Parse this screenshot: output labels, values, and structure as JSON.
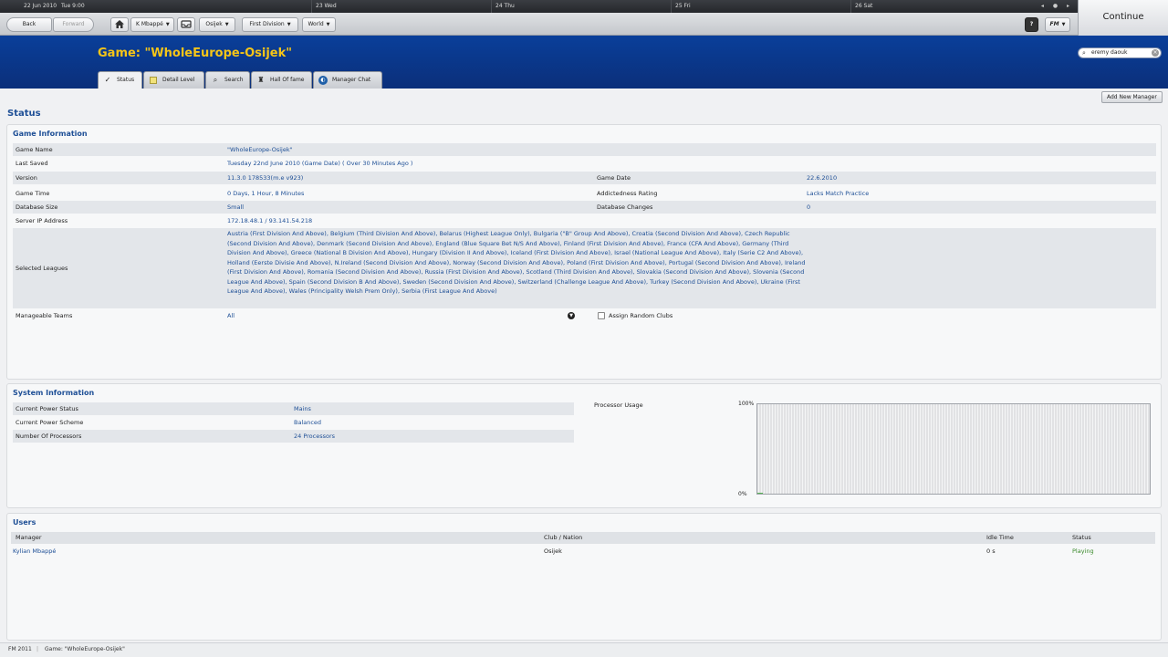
{
  "calendar": {
    "current": "22 Jun 2010",
    "current_time": "Tue 9:00",
    "days": [
      "23 Wed",
      "24 Thu",
      "25 Fri",
      "26 Sat"
    ],
    "nav": "◂ ● ▸"
  },
  "toolbar": {
    "back_label": "Back",
    "forward_label": "Forward",
    "manager_label": "K Mbappé",
    "club_label": "Osijek",
    "division_label": "First Division",
    "world_label": "World",
    "help_label": "?",
    "fm_label": "FM",
    "continue_label": "Continue"
  },
  "header": {
    "title": "Game: \"WholeEurope-Osijek\"",
    "search_value": "eremy daouk"
  },
  "tabs": [
    {
      "label": "Status",
      "icon": "check-icon"
    },
    {
      "label": "Detail Level",
      "icon": "note-icon"
    },
    {
      "label": "Search",
      "icon": "search-icon"
    },
    {
      "label": "Hall Of fame",
      "icon": "trophy-icon"
    },
    {
      "label": "Manager Chat",
      "icon": "chat-icon"
    }
  ],
  "main": {
    "add_manager_label": "Add New Manager",
    "section_title": "Status"
  },
  "game_info": {
    "heading": "Game Information",
    "game_name_label": "Game Name",
    "game_name": "\"WholeEurope-Osijek\"",
    "last_saved_label": "Last Saved",
    "last_saved": "Tuesday 22nd June 2010 (Game Date) ( Over 30 Minutes Ago )",
    "version_label": "Version",
    "version": "11.3.0 178533(m.e v923)",
    "game_date_label": "Game Date",
    "game_date": "22.6.2010",
    "game_time_label": "Game Time",
    "game_time": "0 Days, 1 Hour, 8 Minutes",
    "addictedness_label": "Addictedness Rating",
    "addictedness": "Lacks Match Practice",
    "db_size_label": "Database Size",
    "db_size": "Small",
    "db_changes_label": "Database Changes",
    "db_changes": "0",
    "server_ip_label": "Server IP Address",
    "server_ip": "172.18.48.1 / 93.141.54.218",
    "leagues_label": "Selected Leagues",
    "leagues": "Austria (First Division And Above), Belgium (Third Division And Above), Belarus (Highest League Only), Bulgaria (\"B\" Group And Above), Croatia (Second Division And Above), Czech Republic (Second Division And Above), Denmark (Second Division And Above), England (Blue Square Bet N/S And Above), Finland (First Division And Above), France (CFA And Above), Germany (Third Division And Above), Greece (National B Division And Above), Hungary (Division II And Above), Iceland (First Division And Above), Israel (National League And Above), Italy (Serie C2 And Above), Holland (Eerste Divisie And Above), N.Ireland (Second Division And Above), Norway (Second Division And Above), Poland (First Division And Above), Portugal (Second Division And Above), Ireland (First Division And Above), Romania (Second Division And Above), Russia (First Division And Above), Scotland (Third Division And Above), Slovakia (Second Division And Above), Slovenia (Second League And Above), Spain (Second Division B And Above), Sweden (Second Division And Above), Switzerland (Challenge League And Above), Turkey (Second Division And Above), Ukraine (First League And Above), Wales (Principality Welsh Prem Only), Serbia (First League And Above)",
    "manageable_label": "Manageable Teams",
    "manageable": "All",
    "random_clubs_label": "Assign Random Clubs"
  },
  "system_info": {
    "heading": "System Information",
    "power_status_label": "Current Power Status",
    "power_status": "Mains",
    "power_scheme_label": "Current Power Scheme",
    "power_scheme": "Balanced",
    "processors_label": "Number Of Processors",
    "processors": "24 Processors",
    "proc_usage_label": "Processor Usage",
    "y_max_label": "100%",
    "y_min_label": "0%"
  },
  "chart_data": {
    "type": "line",
    "title": "Processor Usage",
    "ylim": [
      0,
      100
    ],
    "ytick_labels": [
      "100%",
      "0%"
    ],
    "series": [
      {
        "values": [
          1,
          1,
          1
        ]
      }
    ],
    "grid": true
  },
  "users": {
    "heading": "Users",
    "columns": [
      "Manager",
      "Club / Nation",
      "Idle Time",
      "Status"
    ],
    "rows": [
      {
        "manager": "Kylian Mbappé",
        "club": "Osijek",
        "idle": "0 s",
        "status": "Playing"
      }
    ]
  },
  "statusbar": {
    "app": "FM 2011",
    "game": "Game: \"WholeEurope-Osijek\""
  },
  "colors": {
    "header_blue": "#0b3a8c",
    "title_yellow": "#f5c518",
    "link_blue": "#1e4f96",
    "status_green": "#3a8a2a"
  }
}
